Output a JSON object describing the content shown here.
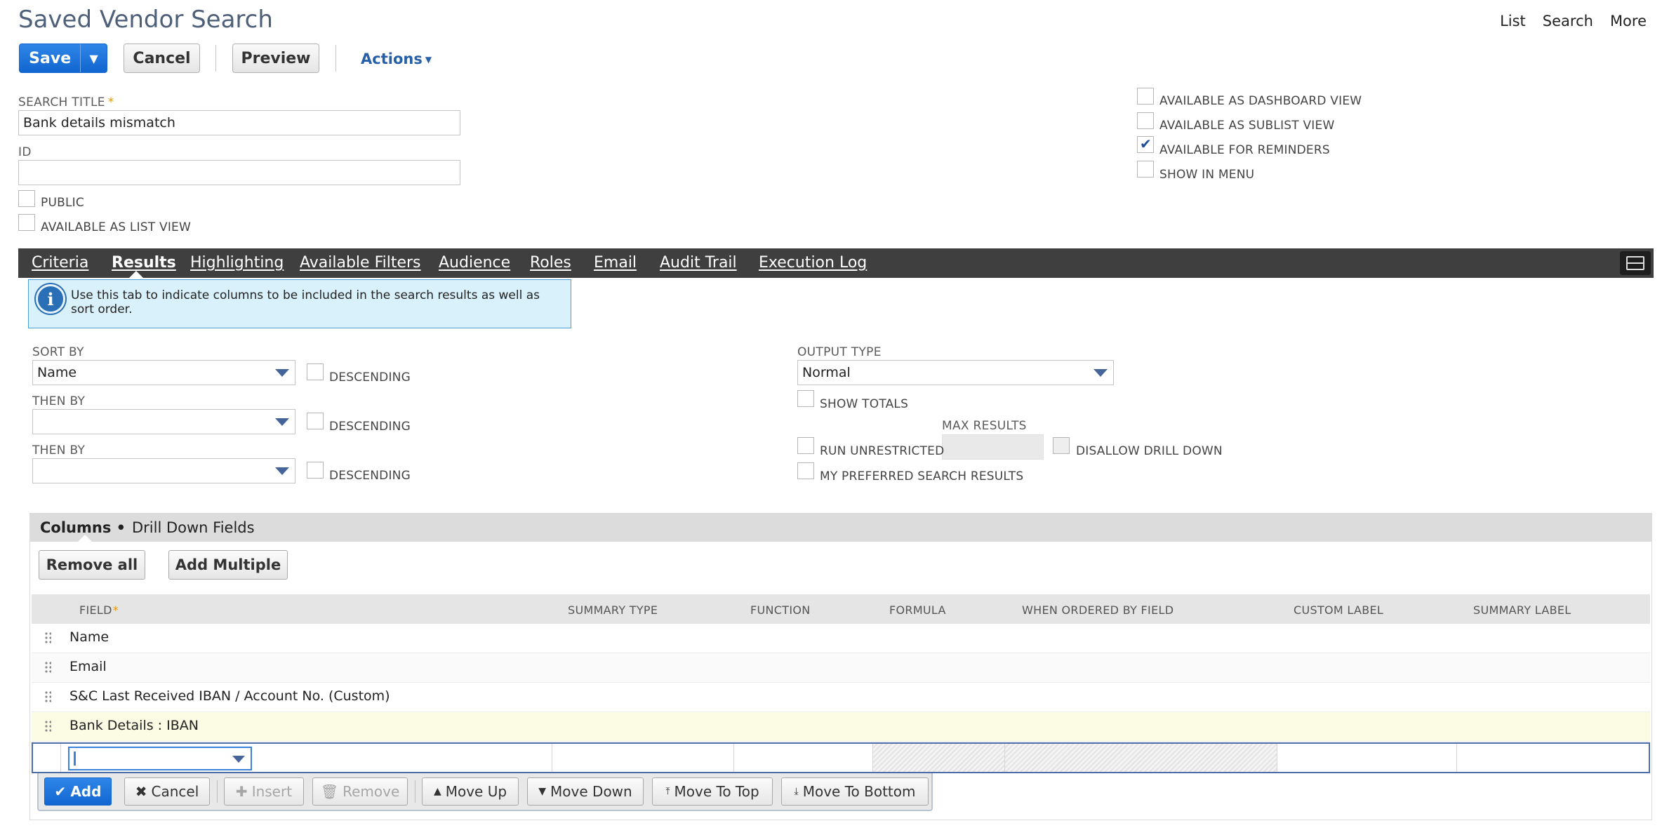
{
  "header": {
    "title": "Saved Vendor Search",
    "links": [
      "List",
      "Search",
      "More"
    ]
  },
  "toolbar": {
    "save_label": "Save",
    "save_split_icon": "▼",
    "cancel_label": "Cancel",
    "preview_label": "Preview",
    "actions_label": "Actions"
  },
  "form": {
    "search_title_label": "SEARCH TITLE",
    "search_title_value": "Bank details mismatch",
    "id_label": "ID",
    "id_value": "",
    "public_label": "PUBLIC",
    "public_checked": false,
    "list_view_label": "AVAILABLE AS LIST VIEW",
    "list_view_checked": false,
    "dashboard_view_label": "AVAILABLE AS DASHBOARD VIEW",
    "dashboard_view_checked": false,
    "sublist_view_label": "AVAILABLE AS SUBLIST VIEW",
    "sublist_view_checked": false,
    "reminders_label": "AVAILABLE FOR REMINDERS",
    "reminders_checked": true,
    "show_in_menu_label": "SHOW IN MENU",
    "show_in_menu_checked": false
  },
  "tabs": [
    {
      "label": "Criteria",
      "active": false
    },
    {
      "label": "Results",
      "active": true
    },
    {
      "label": "Highlighting",
      "active": false
    },
    {
      "label": "Available Filters",
      "active": false
    },
    {
      "label": "Audience",
      "active": false
    },
    {
      "label": "Roles",
      "active": false
    },
    {
      "label": "Email",
      "active": false
    },
    {
      "label": "Audit Trail",
      "active": false
    },
    {
      "label": "Execution Log",
      "active": false
    }
  ],
  "info": {
    "text": "Use this tab to indicate columns to be included in the search results as well as sort order."
  },
  "sort": {
    "sort_by_label": "SORT BY",
    "sort_by_value": "Name",
    "then_by_1_label": "THEN BY",
    "then_by_1_value": "",
    "then_by_2_label": "THEN BY",
    "then_by_2_value": "",
    "descending_label": "DESCENDING"
  },
  "output": {
    "output_type_label": "OUTPUT TYPE",
    "output_type_value": "Normal",
    "show_totals_label": "SHOW TOTALS",
    "max_results_label": "MAX RESULTS",
    "run_unrestricted_label": "RUN UNRESTRICTED",
    "disallow_drill_down_label": "DISALLOW DRILL DOWN",
    "preferred_results_label": "MY PREFERRED SEARCH RESULTS"
  },
  "subtabs": {
    "columns_label": "Columns •",
    "drill_down_label": "Drill Down Fields"
  },
  "sublist_buttons": {
    "remove_all": "Remove all",
    "add_multiple": "Add Multiple"
  },
  "grid": {
    "headers": {
      "field": "FIELD",
      "summary_type": "SUMMARY TYPE",
      "function": "FUNCTION",
      "formula": "FORMULA",
      "when_ordered_by_field": "WHEN ORDERED BY FIELD",
      "custom_label": "CUSTOM LABEL",
      "summary_label": "SUMMARY LABEL"
    },
    "rows": [
      {
        "field": "Name"
      },
      {
        "field": "Email"
      },
      {
        "field": "S&C Last Received IBAN / Account No. (Custom)"
      },
      {
        "field": "Bank Details : IBAN"
      }
    ]
  },
  "edit_toolbar": {
    "add": "Add",
    "cancel": "Cancel",
    "insert": "Insert",
    "remove": "Remove",
    "move_up": "Move Up",
    "move_down": "Move Down",
    "move_to_top": "Move To Top",
    "move_to_bottom": "Move To Bottom"
  },
  "colors": {
    "primary": "#1266d0",
    "title": "#4d5f79",
    "tabbar": "#3f3f3f",
    "info_bg": "#d9f1fb",
    "highlight_row": "#fcfbe4"
  }
}
